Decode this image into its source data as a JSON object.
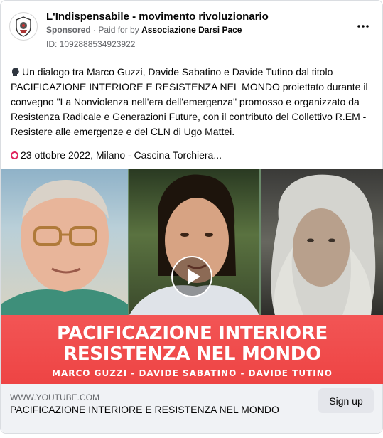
{
  "ad": {
    "page_name": "L'Indispensabile - movimento rivoluzionario",
    "sponsored_label": "Sponsored",
    "paid_prefix": "Paid for by",
    "payer": "Associazione Darsi Pace",
    "id_label": "ID: 1092888534923922",
    "more_icon": "more-options-icon"
  },
  "post": {
    "speaking_icon": "speaking-head-icon",
    "text": "Un dialogo tra Marco Guzzi, Davide Sabatino e Davide Tutino dal titolo PACIFICAZIONE INTERIORE E RESISTENZA NEL MONDO proiettato durante il convegno \"La Nonviolenza nell'era dell'emergenza\" promosso e organizzato da Resistenza Radicale e Generazioni Future, con il contributo del Collettivo R.EM - Resistere alle emergenze e del CLN di Ugo Mattei.",
    "date_icon": "red-circle-icon",
    "date_line": "23 ottobre 2022, Milano - Cascina Torchiera..."
  },
  "video": {
    "banner_line1": "PACIFICAZIONE INTERIORE",
    "banner_line2": "RESISTENZA NEL MONDO",
    "banner_names": "MARCO GUZZI - DAVIDE SABATINO - DAVIDE TUTINO",
    "play_icon": "play-icon",
    "banner_color": "#ef4747"
  },
  "link": {
    "domain": "WWW.YOUTUBE.COM",
    "title": "PACIFICAZIONE INTERIORE E RESISTENZA NEL MONDO",
    "cta": "Sign up"
  }
}
